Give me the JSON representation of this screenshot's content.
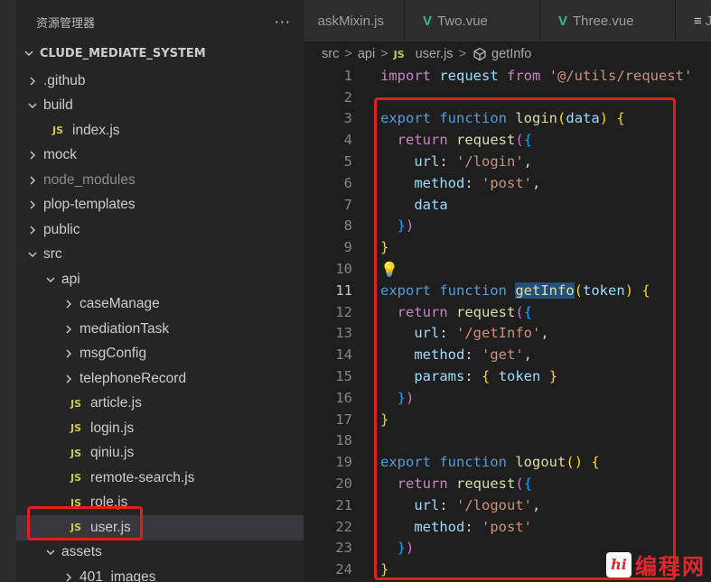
{
  "explorer": {
    "title": "资源管理器",
    "more": "···",
    "root": "CLUDE_MEDIATE_SYSTEM",
    "items": [
      {
        "label": ".github",
        "type": "folder",
        "open": false,
        "depth": 0
      },
      {
        "label": "build",
        "type": "folder",
        "open": true,
        "depth": 0
      },
      {
        "label": "index.js",
        "type": "js",
        "depth": 1
      },
      {
        "label": "mock",
        "type": "folder",
        "open": false,
        "depth": 0
      },
      {
        "label": "node_modules",
        "type": "folder",
        "open": false,
        "depth": 0,
        "dim": true
      },
      {
        "label": "plop-templates",
        "type": "folder",
        "open": false,
        "depth": 0
      },
      {
        "label": "public",
        "type": "folder",
        "open": false,
        "depth": 0
      },
      {
        "label": "src",
        "type": "folder",
        "open": true,
        "depth": 0
      },
      {
        "label": "api",
        "type": "folder",
        "open": true,
        "depth": 1
      },
      {
        "label": "caseManage",
        "type": "folder",
        "open": false,
        "depth": 2
      },
      {
        "label": "mediationTask",
        "type": "folder",
        "open": false,
        "depth": 2
      },
      {
        "label": "msgConfig",
        "type": "folder",
        "open": false,
        "depth": 2
      },
      {
        "label": "telephoneRecord",
        "type": "folder",
        "open": false,
        "depth": 2
      },
      {
        "label": "article.js",
        "type": "js",
        "depth": 2
      },
      {
        "label": "login.js",
        "type": "js",
        "depth": 2
      },
      {
        "label": "qiniu.js",
        "type": "js",
        "depth": 2
      },
      {
        "label": "remote-search.js",
        "type": "js",
        "depth": 2
      },
      {
        "label": "role.js",
        "type": "js",
        "depth": 2
      },
      {
        "label": "user.js",
        "type": "js",
        "depth": 2,
        "selected": true
      },
      {
        "label": "assets",
        "type": "folder",
        "open": true,
        "depth": 1
      },
      {
        "label": "401_images",
        "type": "folder",
        "open": false,
        "depth": 2
      }
    ]
  },
  "tabs": [
    {
      "label": "askMixin.js",
      "kind": "js"
    },
    {
      "label": "Two.vue",
      "kind": "vue"
    },
    {
      "label": "Three.vue",
      "kind": "vue"
    },
    {
      "label": "J...",
      "kind": "menu"
    }
  ],
  "breadcrumb": {
    "seg1": "src",
    "seg2": "api",
    "seg3": "user.js",
    "seg4": "getInfo",
    "sep": ">"
  },
  "js_badge": "JS",
  "code": {
    "active_line": 11,
    "lines": [
      {
        "n": "1",
        "t": [
          [
            "kw2",
            "import"
          ],
          [
            "plain",
            " "
          ],
          [
            "var",
            "request"
          ],
          [
            "plain",
            " "
          ],
          [
            "kw2",
            "from"
          ],
          [
            "plain",
            " "
          ],
          [
            "str",
            "'@/utils/request'"
          ]
        ]
      },
      {
        "n": "2",
        "t": []
      },
      {
        "n": "3",
        "t": [
          [
            "kw",
            "export"
          ],
          [
            "plain",
            " "
          ],
          [
            "kw",
            "function"
          ],
          [
            "plain",
            " "
          ],
          [
            "fn",
            "login"
          ],
          [
            "brace",
            "("
          ],
          [
            "var",
            "data"
          ],
          [
            "brace",
            ")"
          ],
          [
            "plain",
            " "
          ],
          [
            "brace",
            "{"
          ]
        ]
      },
      {
        "n": "4",
        "t": [
          [
            "plain",
            "  "
          ],
          [
            "kw2",
            "return"
          ],
          [
            "plain",
            " "
          ],
          [
            "fn",
            "request"
          ],
          [
            "brace2",
            "("
          ],
          [
            "brace3",
            "{"
          ]
        ]
      },
      {
        "n": "5",
        "t": [
          [
            "plain",
            "    "
          ],
          [
            "var",
            "url"
          ],
          [
            "plain",
            ": "
          ],
          [
            "str",
            "'/login'"
          ],
          [
            "plain",
            ","
          ]
        ]
      },
      {
        "n": "6",
        "t": [
          [
            "plain",
            "    "
          ],
          [
            "var",
            "method"
          ],
          [
            "plain",
            ": "
          ],
          [
            "str",
            "'post'"
          ],
          [
            "plain",
            ","
          ]
        ]
      },
      {
        "n": "7",
        "t": [
          [
            "plain",
            "    "
          ],
          [
            "var",
            "data"
          ]
        ]
      },
      {
        "n": "8",
        "t": [
          [
            "plain",
            "  "
          ],
          [
            "brace3",
            "}"
          ],
          [
            "brace2",
            ")"
          ]
        ]
      },
      {
        "n": "9",
        "t": [
          [
            "brace",
            "}"
          ]
        ]
      },
      {
        "n": "10",
        "t": [
          [
            "bulb",
            "💡"
          ]
        ]
      },
      {
        "n": "11",
        "t": [
          [
            "kw",
            "export"
          ],
          [
            "plain",
            " "
          ],
          [
            "kw",
            "function"
          ],
          [
            "plain",
            " "
          ],
          [
            "fnhl",
            "getInfo"
          ],
          [
            "brace",
            "("
          ],
          [
            "var",
            "token"
          ],
          [
            "brace",
            ")"
          ],
          [
            "plain",
            " "
          ],
          [
            "brace",
            "{"
          ]
        ]
      },
      {
        "n": "12",
        "t": [
          [
            "plain",
            "  "
          ],
          [
            "kw2",
            "return"
          ],
          [
            "plain",
            " "
          ],
          [
            "fn",
            "request"
          ],
          [
            "brace2",
            "("
          ],
          [
            "brace3",
            "{"
          ]
        ]
      },
      {
        "n": "13",
        "t": [
          [
            "plain",
            "    "
          ],
          [
            "var",
            "url"
          ],
          [
            "plain",
            ": "
          ],
          [
            "str",
            "'/getInfo'"
          ],
          [
            "plain",
            ","
          ]
        ]
      },
      {
        "n": "14",
        "t": [
          [
            "plain",
            "    "
          ],
          [
            "var",
            "method"
          ],
          [
            "plain",
            ": "
          ],
          [
            "str",
            "'get'"
          ],
          [
            "plain",
            ","
          ]
        ]
      },
      {
        "n": "15",
        "t": [
          [
            "plain",
            "    "
          ],
          [
            "var",
            "params"
          ],
          [
            "plain",
            ": "
          ],
          [
            "brace",
            "{"
          ],
          [
            "plain",
            " "
          ],
          [
            "var",
            "token"
          ],
          [
            "plain",
            " "
          ],
          [
            "brace",
            "}"
          ]
        ]
      },
      {
        "n": "16",
        "t": [
          [
            "plain",
            "  "
          ],
          [
            "brace3",
            "}"
          ],
          [
            "brace2",
            ")"
          ]
        ]
      },
      {
        "n": "17",
        "t": [
          [
            "brace",
            "}"
          ]
        ]
      },
      {
        "n": "18",
        "t": []
      },
      {
        "n": "19",
        "t": [
          [
            "kw",
            "export"
          ],
          [
            "plain",
            " "
          ],
          [
            "kw",
            "function"
          ],
          [
            "plain",
            " "
          ],
          [
            "fn",
            "logout"
          ],
          [
            "brace",
            "("
          ],
          [
            "brace",
            ")"
          ],
          [
            "plain",
            " "
          ],
          [
            "brace",
            "{"
          ]
        ]
      },
      {
        "n": "20",
        "t": [
          [
            "plain",
            "  "
          ],
          [
            "kw2",
            "return"
          ],
          [
            "plain",
            " "
          ],
          [
            "fn",
            "request"
          ],
          [
            "brace2",
            "("
          ],
          [
            "brace3",
            "{"
          ]
        ]
      },
      {
        "n": "21",
        "t": [
          [
            "plain",
            "    "
          ],
          [
            "var",
            "url"
          ],
          [
            "plain",
            ": "
          ],
          [
            "str",
            "'/logout'"
          ],
          [
            "plain",
            ","
          ]
        ]
      },
      {
        "n": "22",
        "t": [
          [
            "plain",
            "    "
          ],
          [
            "var",
            "method"
          ],
          [
            "plain",
            ": "
          ],
          [
            "str",
            "'post'"
          ]
        ]
      },
      {
        "n": "23",
        "t": [
          [
            "plain",
            "  "
          ],
          [
            "brace3",
            "}"
          ],
          [
            "brace2",
            ")"
          ]
        ]
      },
      {
        "n": "24",
        "t": [
          [
            "brace",
            "}"
          ]
        ]
      }
    ]
  },
  "watermark": {
    "logo": "hi",
    "text": "编程网"
  },
  "colors": {
    "highlight_box": "#e02020",
    "js_badge": "#cbcb41",
    "vue_icon": "#41b883"
  }
}
